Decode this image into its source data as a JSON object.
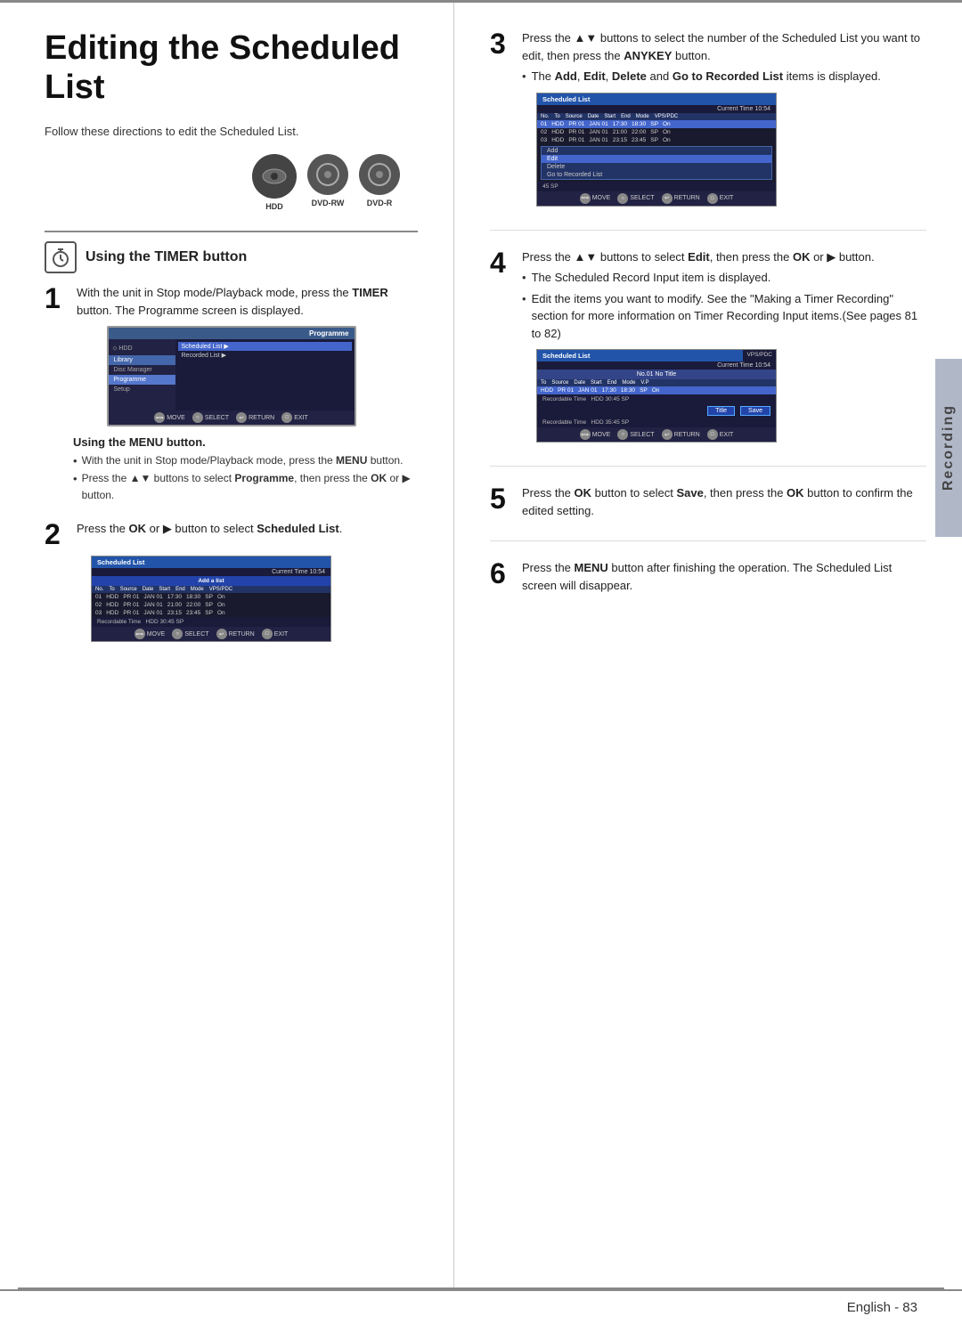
{
  "page": {
    "title": "Editing the Scheduled List",
    "intro": "Follow these directions to edit the Scheduled List.",
    "page_number": "English - 83",
    "recording_label": "Recording"
  },
  "icons": [
    {
      "label": "HDD",
      "symbol": "HDD"
    },
    {
      "label": "DVD-RW",
      "symbol": "DVD-RW"
    },
    {
      "label": "DVD-R",
      "symbol": "DVD-R"
    }
  ],
  "timer_section": {
    "title": "Using the TIMER button"
  },
  "steps": {
    "step1": {
      "number": "1",
      "text": "With the unit in Stop mode/Playback mode, press the TIMER button. The Programme screen is displayed."
    },
    "step1_menu_title": "Using the MENU button.",
    "step1_menu_bullets": [
      "With the unit in Stop mode/Playback mode, press the MENU button.",
      "Press the ▲▼ buttons to select Programme, then press the OK or ▶ button."
    ],
    "step2": {
      "number": "2",
      "text": "Press the OK or ▶ button to select Scheduled List."
    },
    "step3": {
      "number": "3",
      "text": "Press the ▲▼ buttons to select the number of the Scheduled List you want to edit, then press the ANYKEY button.",
      "bullet": "The Add, Edit, Delete and Go to Recorded List items is displayed."
    },
    "step4": {
      "number": "4",
      "text": "Press the ▲▼ buttons to select Edit, then press the OK or ▶ button.",
      "bullets": [
        "The Scheduled Record Input item is displayed.",
        "Edit the items you want to modify. See the \"Making a Timer Recording\" section for more information on Timer Recording Input items.(See pages 81 to 82)"
      ]
    },
    "step5": {
      "number": "5",
      "text": "Press the OK button to select Save, then press the OK button to confirm the edited setting."
    },
    "step6": {
      "number": "6",
      "text": "Press the MENU button after finishing the operation. The Scheduled List screen will disappear."
    }
  },
  "screens": {
    "programme_screen": {
      "title": "Programme",
      "hdd_label": "HDD",
      "items": [
        "Library",
        "Disc Manager",
        "Programme",
        "Setup"
      ],
      "sub_items": [
        "Scheduled List",
        "Recorded List"
      ],
      "nav": [
        "MOVE",
        "SELECT",
        "RETURN",
        "EXIT"
      ]
    },
    "scheduled_list_1": {
      "title": "Scheduled List",
      "time": "Current Time 10:54",
      "add_label": "Add a list",
      "columns": [
        "No.",
        "To",
        "Source",
        "Date",
        "Start",
        "End",
        "Mode",
        "VPS/PDC"
      ],
      "rows": [
        [
          "01",
          "HDD",
          "PR 01",
          "JAN 01",
          "17:30",
          "18:30",
          "SP",
          "On"
        ],
        [
          "02",
          "HDD",
          "PR 01",
          "JAN 01",
          "21:00",
          "22:00",
          "SP",
          "On"
        ],
        [
          "03",
          "HDD",
          "PR 01",
          "JAN 01",
          "23:15",
          "23:45",
          "SP",
          "On"
        ]
      ],
      "recordable": "Recordable Time  HDD 30:45 SP",
      "nav": [
        "MOVE",
        "SELECT",
        "RETURN",
        "EXIT"
      ]
    },
    "scheduled_list_2": {
      "title": "Scheduled List",
      "time": "Current Time 10:54",
      "columns": [
        "No.",
        "To",
        "Source",
        "Date",
        "Start",
        "End",
        "Mode",
        "VPS/PDC"
      ],
      "rows": [
        [
          "01",
          "HDD",
          "PR 01",
          "JAN 01",
          "17:30",
          "18:30",
          "SP",
          "On"
        ],
        [
          "02",
          "HDD",
          "PR 01",
          "JAN 01",
          "21:00",
          "22:00",
          "SP",
          "On"
        ],
        [
          "03",
          "HDD",
          "PR 01",
          "JAN 01",
          "23:15",
          "23:45",
          "SP",
          "On"
        ]
      ],
      "menu_items": [
        "Add",
        "Edit",
        "Delete",
        "Go to Recorded List"
      ],
      "footer_time": "45 SP",
      "nav": [
        "MOVE",
        "SELECT",
        "RETURN",
        "EXIT"
      ]
    },
    "scheduled_list_edit": {
      "title": "Scheduled List",
      "time": "Current Time 10:54",
      "vps": "VPS/PDC",
      "no_title": "No.01 No Title",
      "columns": [
        "To",
        "Source",
        "Date",
        "Start",
        "End",
        "Mode",
        "V.P"
      ],
      "row": [
        "HDD",
        "PR 01",
        "JAN 01",
        "17:30",
        "18:30",
        "SP",
        "On"
      ],
      "recordable1": "Recordable Time  HDD 30:45 SP",
      "buttons": [
        "Title",
        "Save"
      ],
      "recordable2": "Recordable Time  HDD 35:45 SP",
      "nav": [
        "MOVE",
        "SELECT",
        "RETURN",
        "EXIT"
      ]
    }
  }
}
